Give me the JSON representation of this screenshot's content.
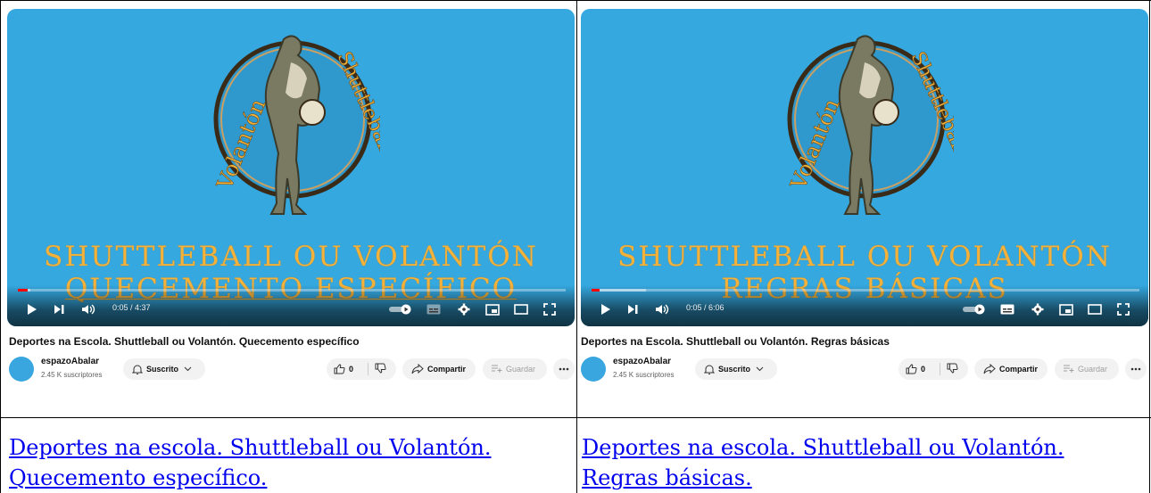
{
  "videos": [
    {
      "caption_line1": "SHUTTLEBALL OU VOLANTÓN",
      "caption_line2": "QUECEMENTO ESPECÍFICO",
      "logo_text_left": "Volantón",
      "logo_text_right": "Shuttleball",
      "time": "0:05 / 4:37",
      "progress_fraction": 0.018,
      "title": "Deportes na Escola. Shuttleball ou Volantón. Quecemento específico",
      "channel": "espazoAbalar",
      "subscribers": "2.45 K suscriptores",
      "subscribe_label": "Suscrito",
      "like_count": "0",
      "share_label": "Compartir",
      "save_label": "Guardar",
      "link_text": "Deportes na escola. Shuttleball ou Volantón. Quecemento específico."
    },
    {
      "caption_line1": "SHUTTLEBALL OU VOLANTÓN",
      "caption_line2": "REGRAS BÁSICAS",
      "logo_text_left": "Volantón",
      "logo_text_right": "Shuttleball",
      "time": "0:05 / 6:06",
      "progress_fraction": 0.014,
      "title": "Deportes na Escola. Shuttleball ou Volantón. Regras básicas",
      "channel": "espazoAbalar",
      "subscribers": "2.45 K suscriptores",
      "subscribe_label": "Suscrito",
      "like_count": "0",
      "share_label": "Compartir",
      "save_label": "Guardar",
      "link_text": "Deportes na escola. Shuttleball ou Volantón. Regras básicas."
    }
  ],
  "colors": {
    "video_bg": "#35a8e0",
    "caption": "#f4b23a",
    "progress": "#ff0000",
    "link": "#0000ee"
  },
  "icons": [
    "play-icon",
    "next-icon",
    "volume-icon",
    "autoplay-toggle-icon",
    "subtitles-icon",
    "settings-icon",
    "miniplayer-icon",
    "theater-icon",
    "fullscreen-icon",
    "bell-icon",
    "chevron-down-icon",
    "like-icon",
    "dislike-icon",
    "share-icon",
    "save-icon",
    "more-icon"
  ]
}
